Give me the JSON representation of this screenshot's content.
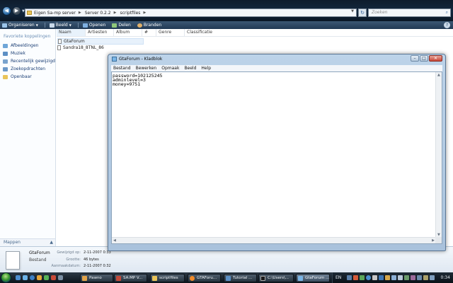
{
  "explorer": {
    "breadcrumbs": [
      "Eigen Sa-mp server",
      "Server 0.2.2",
      "scriptfiles"
    ],
    "search_placeholder": "Zoeken",
    "toolbar": [
      {
        "label": "Organiseren",
        "icon": "organize-icon",
        "dropdown": true
      },
      {
        "label": "Beeld",
        "icon": "views-icon",
        "dropdown": true
      },
      {
        "label": "Openen",
        "icon": "open-icon",
        "dropdown": false
      },
      {
        "label": "Delen",
        "icon": "share-icon",
        "dropdown": false
      },
      {
        "label": "Branden",
        "icon": "burn-icon",
        "dropdown": false
      }
    ],
    "favorites_title": "Favoriete koppelingen",
    "favorites": [
      {
        "label": "Afbeeldingen",
        "icon": "pictures-icon"
      },
      {
        "label": "Muziek",
        "icon": "music-icon"
      },
      {
        "label": "Recentelijk gewijzigd",
        "icon": "recent-icon"
      },
      {
        "label": "Zoekopdrachten",
        "icon": "searches-icon"
      },
      {
        "label": "Openbaar",
        "icon": "public-folder-icon"
      }
    ],
    "folders_label": "Mappen",
    "columns": [
      "Naam",
      "Artiesten",
      "Album",
      "#",
      "Genre",
      "Classificatie"
    ],
    "files": [
      {
        "name": "GtaForum",
        "selected": true
      },
      {
        "name": "Sandra18_8TNL_86",
        "selected": false
      }
    ],
    "details": {
      "name": "GtaForum",
      "type": "Bestand",
      "modified_label": "Gewijzigd op:",
      "modified_value": "2-11-2007 0:33",
      "size_label": "Grootte:",
      "size_value": "46 bytes",
      "created_label": "Aanmaakdatum:",
      "created_value": "2-11-2007 0:32"
    }
  },
  "notepad": {
    "title": "GtaForum - Kladblok",
    "menu": [
      "Bestand",
      "Bewerken",
      "Opmaak",
      "Beeld",
      "Help"
    ],
    "lines": [
      "password=102125245",
      "adminlevel=3",
      "money=9751"
    ]
  },
  "taskbar": {
    "buttons": [
      "Pawno",
      "SA:MP V...",
      "scriptfiles",
      "GTAForu...",
      "Tutorial ...",
      "C:\\Users\\...",
      "GtaForum ..."
    ],
    "language": "EN",
    "time": "0:34"
  },
  "colors": {
    "explorer_titlebar": "#13283f",
    "command_bar": "#2c4763",
    "notepad_frame": "#a9c2dc",
    "close_button": "#c84535",
    "taskbar": "#0b141c"
  }
}
